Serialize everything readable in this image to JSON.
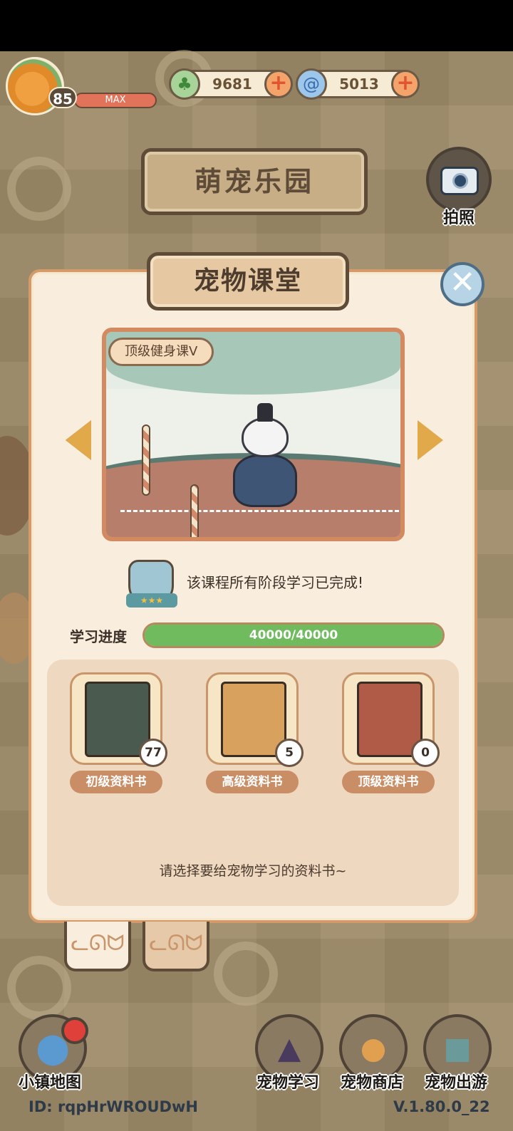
{
  "hud": {
    "level": "85",
    "level_status": "MAX",
    "clover_amount": "9681",
    "gem_amount": "5013",
    "clover_icon": "clover-icon",
    "gem_icon": "swirl-gem-icon"
  },
  "park_sign": "萌宠乐园",
  "camera": {
    "label": "拍照",
    "icon": "camera-icon"
  },
  "panel": {
    "title": "宠物课堂",
    "course_name": "顶级健身课Ⅴ",
    "complete_message": "该课程所有阶段学习已完成!",
    "progress_label": "学习进度",
    "progress_text": "40000/40000",
    "progress_fraction": 1.0,
    "books": [
      {
        "name": "初级资料书",
        "count": "77",
        "color": "#4a5a4e"
      },
      {
        "name": "高级资料书",
        "count": "5",
        "color": "#d9a15e"
      },
      {
        "name": "顶级资料书",
        "count": "0",
        "color": "#b05a48"
      }
    ],
    "choose_hint": "请选择要给宠物学习的资料书~"
  },
  "bottom": {
    "map_label": "小镇地图",
    "study_label": "宠物学习",
    "shop_label": "宠物商店",
    "travel_label": "宠物出游",
    "user_id": "ID: rqpHrWROUDwH",
    "version": "V.1.80.0_22"
  },
  "colors": {
    "accent_orange": "#d48a60",
    "progress_green": "#6fbb5e",
    "panel_bg": "#f9eedd"
  }
}
